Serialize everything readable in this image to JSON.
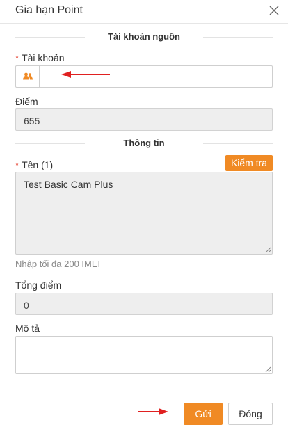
{
  "dialog": {
    "title": "Gia hạn Point",
    "close_label": "X"
  },
  "sections": {
    "source_account": "Tài khoản nguồn",
    "info": "Thông tin"
  },
  "fields": {
    "account": {
      "label": "Tài khoản",
      "required": "*",
      "value": ""
    },
    "points": {
      "label": "Điểm",
      "value": "655"
    },
    "name": {
      "label": "Tên (1)",
      "required": "*",
      "value": "Test Basic Cam Plus",
      "hint": "Nhập tối đa 200 IMEI"
    },
    "total_points": {
      "label": "Tổng điểm",
      "value": "0"
    },
    "description": {
      "label": "Mô tả",
      "value": ""
    }
  },
  "buttons": {
    "check": "Kiểm tra",
    "send": "Gửi",
    "close": "Đóng"
  },
  "colors": {
    "accent": "#f08a24",
    "required": "#e74c3c",
    "annotation_arrow": "#e02020"
  },
  "icons": {
    "account_addon": "users-icon",
    "close": "close-icon"
  }
}
